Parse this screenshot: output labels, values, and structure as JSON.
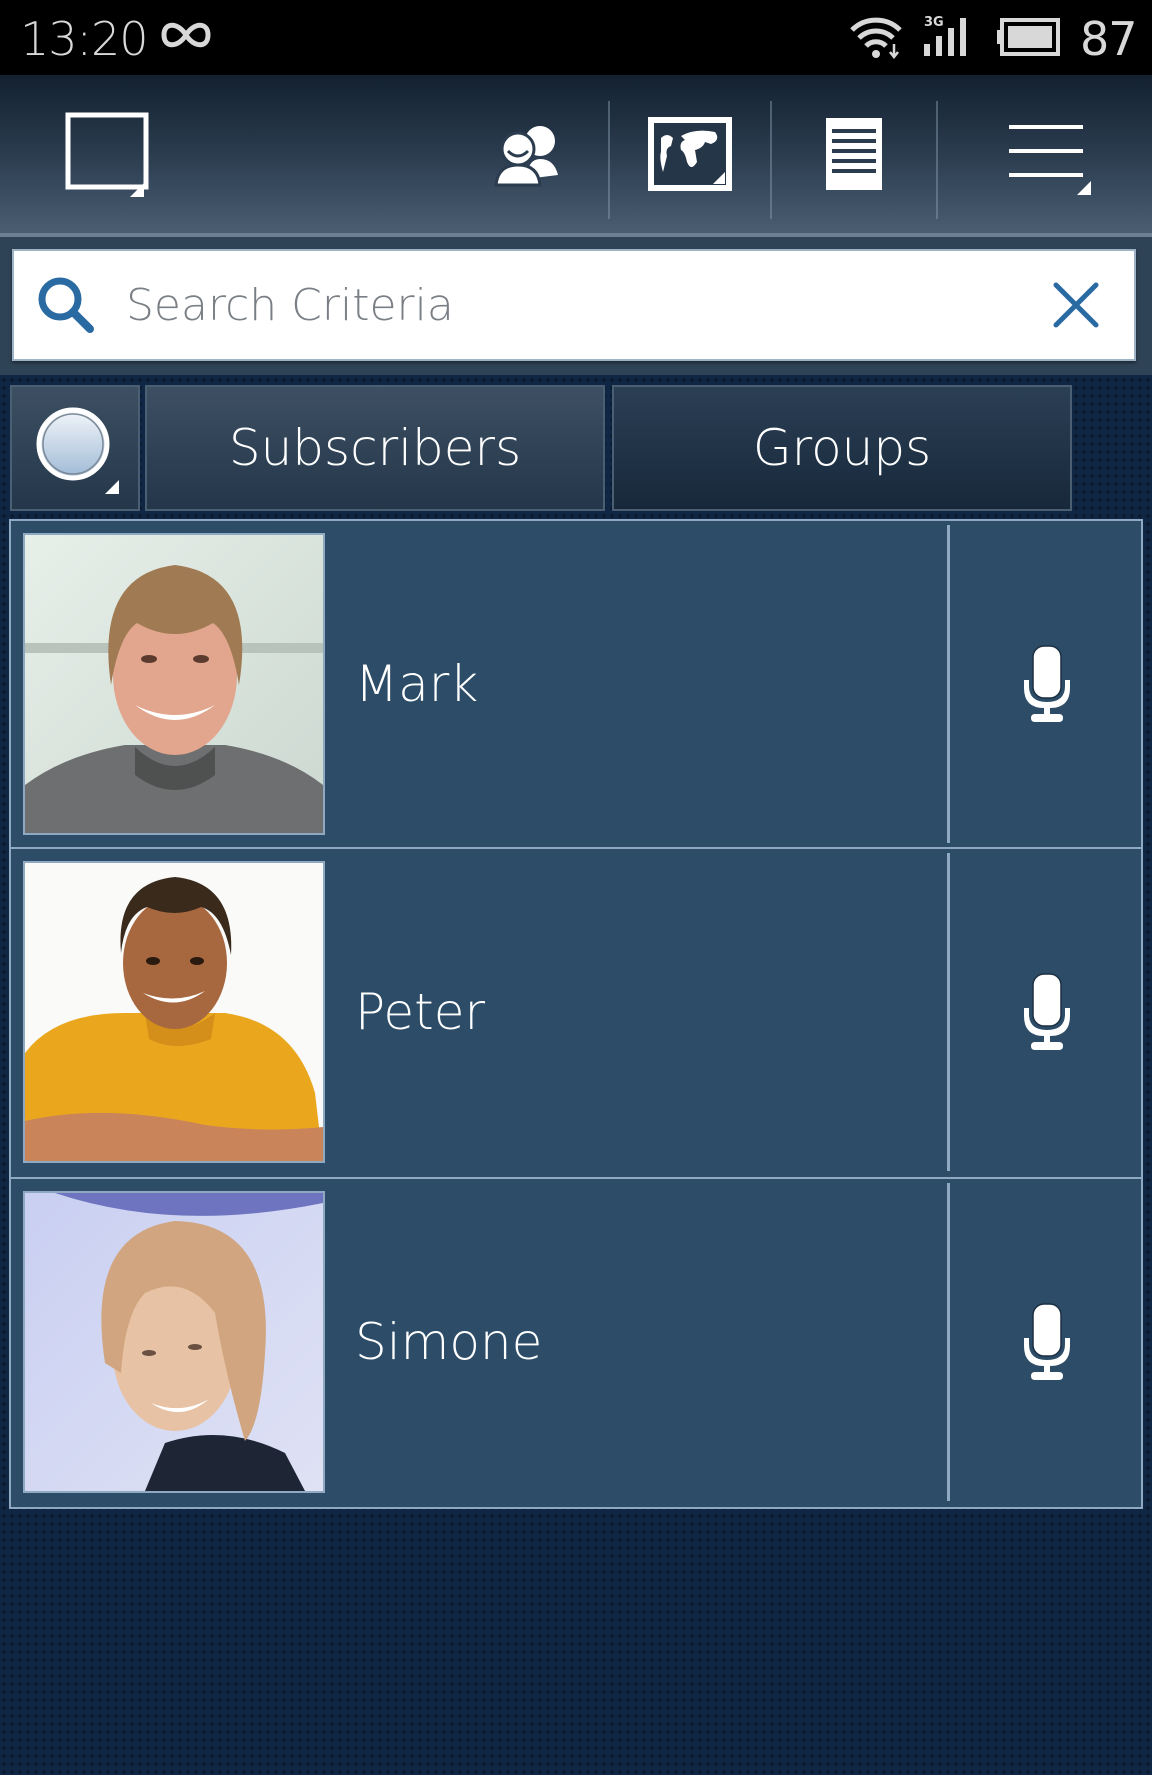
{
  "status_bar": {
    "time": "13:20",
    "left_icons": [
      "infinity-icon"
    ],
    "right_icons": [
      "wifi-icon",
      "signal-3g-icon",
      "battery-icon"
    ],
    "network_label": "3G",
    "battery_percent": "87"
  },
  "toolbar": {
    "buttons": [
      {
        "name": "window-select",
        "icon": "square-window-icon"
      },
      {
        "name": "contacts",
        "icon": "contacts-icon"
      },
      {
        "name": "map",
        "icon": "world-map-icon"
      },
      {
        "name": "log",
        "icon": "document-list-icon"
      },
      {
        "name": "menu",
        "icon": "menu-icon"
      }
    ]
  },
  "search": {
    "placeholder": "Search Criteria",
    "value": "",
    "icon": "search-icon",
    "clear_icon": "close-icon"
  },
  "tabs": {
    "status_icon": "status-circle-icon",
    "items": [
      {
        "label": "Subscribers",
        "selected": false
      },
      {
        "label": "Groups",
        "selected": true
      }
    ]
  },
  "contacts": [
    {
      "name": "Mark",
      "action_icon": "microphone-icon"
    },
    {
      "name": "Peter",
      "action_icon": "microphone-icon"
    },
    {
      "name": "Simone",
      "action_icon": "microphone-icon"
    }
  ],
  "colors": {
    "accent": "#2a6aa3",
    "row_bg": "#2c4c67",
    "row_border": "#8fa9c2",
    "page_bg": "#0f2744"
  }
}
